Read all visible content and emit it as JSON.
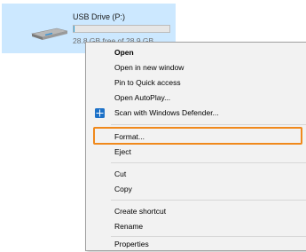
{
  "drive": {
    "name": "USB Drive (P:)",
    "free_text": "28.8 GB free of 28.9 GB",
    "used_fraction": 0.004,
    "icon": "usb-drive-icon"
  },
  "menu": {
    "open": "Open",
    "open_new_window": "Open in new window",
    "pin_quick_access": "Pin to Quick access",
    "open_autoplay": "Open AutoPlay...",
    "scan_defender": "Scan with Windows Defender...",
    "scan_defender_icon": "windows-defender-icon",
    "format": "Format...",
    "eject": "Eject",
    "cut": "Cut",
    "copy": "Copy",
    "create_shortcut": "Create shortcut",
    "rename": "Rename",
    "properties": "Properties"
  },
  "colors": {
    "selection": "#cce8ff",
    "highlight": "#f0891c",
    "menu_bg": "#f2f2f2",
    "defender_blue": "#1e72c8"
  }
}
